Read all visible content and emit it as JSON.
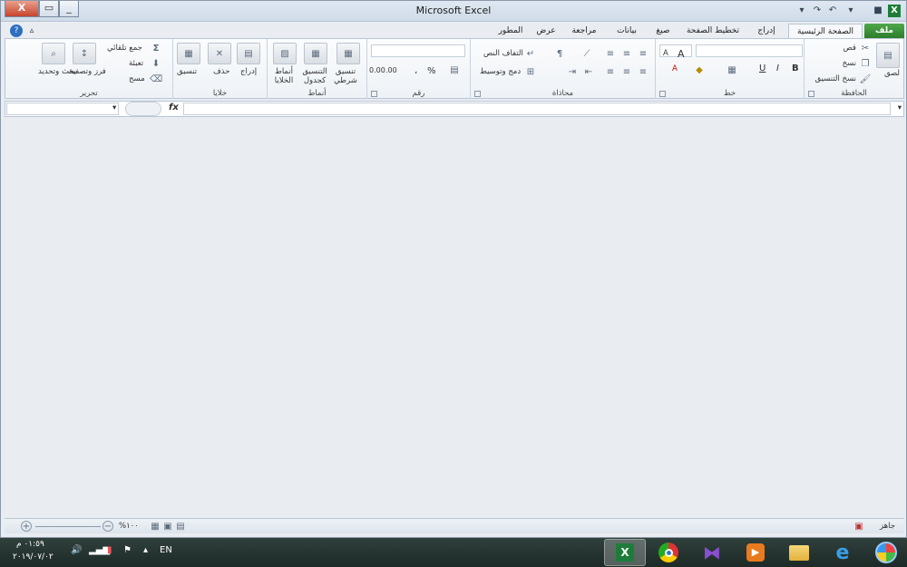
{
  "window": {
    "title": "Microsoft Excel"
  },
  "tabs": [
    "ملف",
    "الصفحة الرئيسية",
    "إدراج",
    "تخطيط الصفحة",
    "صيغ",
    "بيانات",
    "مراجعة",
    "عرض",
    "المطور"
  ],
  "ribbon": {
    "clipboard": {
      "label": "الحافظة",
      "paste": "لصق",
      "cut": "قص",
      "copy": "نسخ",
      "format_painter": "نسخ التنسيق"
    },
    "font": {
      "label": "خط",
      "bold": "B",
      "italic": "I",
      "underline": "U",
      "grow": "A",
      "shrink": "A"
    },
    "alignment": {
      "label": "محاذاة",
      "wrap": "التفاف النص",
      "merge": "دمج وتوسيط"
    },
    "number": {
      "label": "رقم",
      "percent": "%",
      "comma": "،",
      "inc": ".00",
      "dec": "0.00"
    },
    "styles": {
      "label": "أنماط",
      "conditional": "تنسيق شرطي",
      "as_table": "التنسيق كجدول",
      "cell_styles": "أنماط الخلايا"
    },
    "cells": {
      "label": "خلايا",
      "insert": "إدراج",
      "delete": "حذف",
      "format": "تنسيق"
    },
    "editing": {
      "label": "تحرير",
      "autosum": "جمع تلقائي",
      "fill": "تعبئة",
      "clear": "مسح",
      "sort": "فرز وتصفية",
      "find": "بحث وتحديد"
    }
  },
  "formula_bar": {
    "fx": "fx",
    "name": "",
    "formula": ""
  },
  "status": {
    "ready": "جاهز",
    "zoom": "%١٠٠"
  },
  "taskbar": {
    "lang": "EN",
    "time": "٠١:٥٩ م",
    "date": "٢٠١٩/٠٧/٠٢"
  }
}
